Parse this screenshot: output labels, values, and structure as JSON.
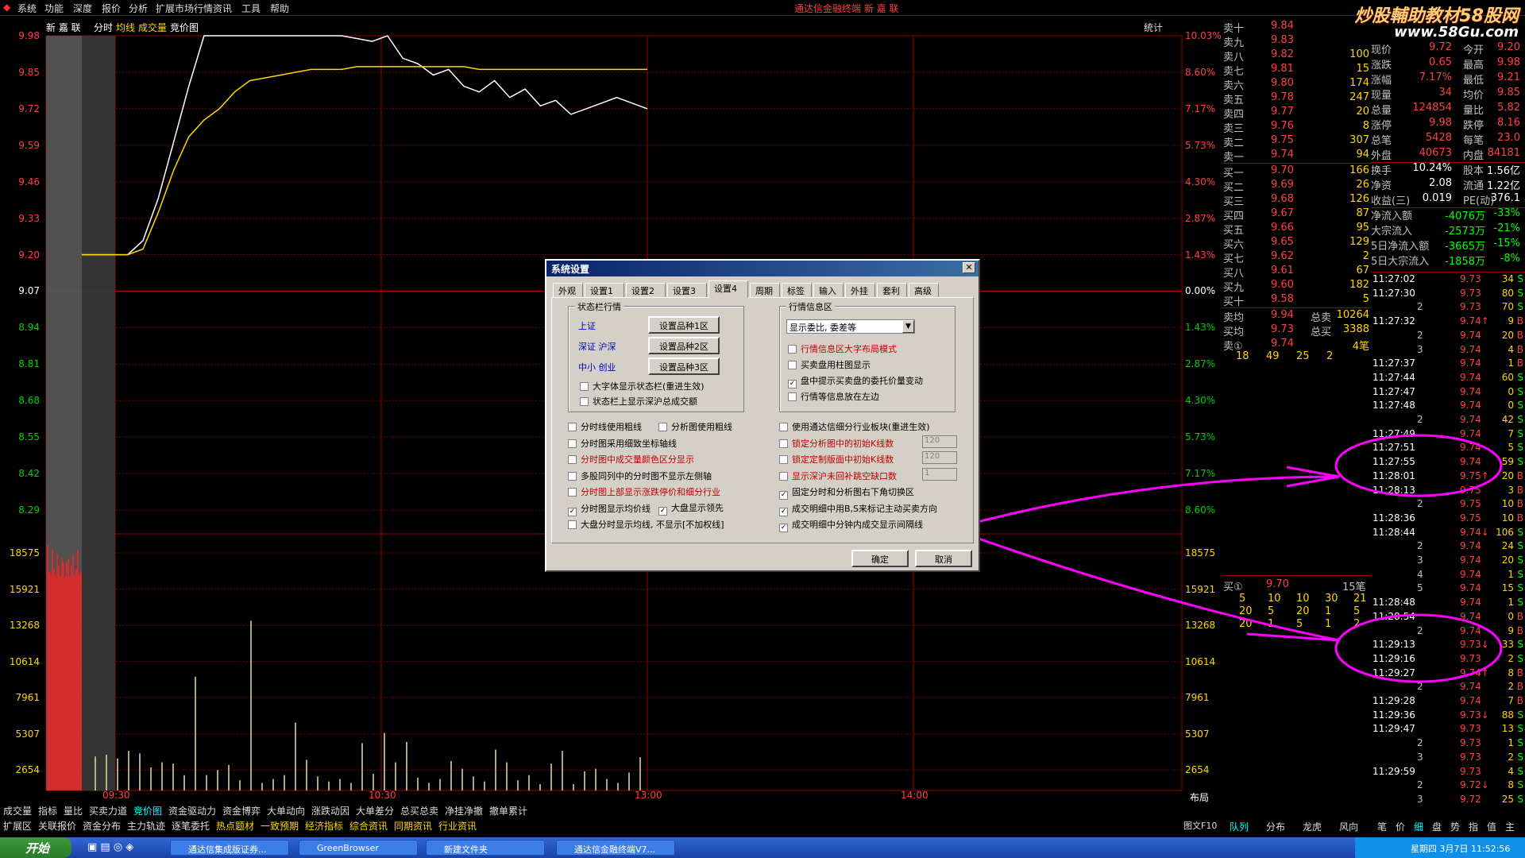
{
  "menu": [
    "系统",
    "功能",
    "深度",
    "报价",
    "分析",
    "扩展市场行情",
    "资讯",
    "工具",
    "帮助"
  ],
  "app_title": "通达信金融终端",
  "stock_name": "新 嘉 联",
  "watermark": {
    "line1": "炒股輔助教材58股网",
    "line2": "www.58Gu.com"
  },
  "chart_header": {
    "stock": "新 嘉 联",
    "items": [
      "分时",
      "均线",
      "成交量",
      "竞价图"
    ],
    "stat": "统计"
  },
  "chart_data": {
    "type": "line",
    "price_axis": [
      "9.98",
      "9.85",
      "9.72",
      "9.59",
      "9.46",
      "9.33",
      "9.20",
      "9.07",
      "8.94",
      "8.81",
      "8.68",
      "8.55",
      "8.42",
      "8.29"
    ],
    "pct_axis": [
      "10.03%",
      "8.60%",
      "7.17%",
      "5.73%",
      "4.30%",
      "2.87%",
      "1.43%",
      "0.00%",
      "1.43%",
      "2.87%",
      "4.30%",
      "5.73%",
      "7.17%",
      "8.60%"
    ],
    "volume_axis": [
      "18575",
      "15921",
      "13268",
      "10614",
      "7961",
      "5307",
      "2654"
    ],
    "time_labels": [
      "09:30",
      "10:30",
      "13:00",
      "14:00"
    ],
    "ylim": [
      8.16,
      9.98
    ],
    "series": [
      {
        "color": "#ffffff",
        "values": [
          9.2,
          9.2,
          9.2,
          9.2,
          9.25,
          9.4,
          9.6,
          9.8,
          9.98,
          9.98,
          9.98,
          9.98,
          9.98,
          9.98,
          9.98,
          9.98,
          9.98,
          9.98,
          9.97,
          9.96,
          9.98,
          9.9,
          9.88,
          9.84,
          9.86,
          9.8,
          9.78,
          9.82,
          9.76,
          9.79,
          9.73,
          9.75,
          9.7,
          9.72,
          9.74,
          9.76,
          9.74,
          9.72
        ]
      },
      {
        "color": "#ffd700",
        "values": [
          9.2,
          9.2,
          9.2,
          9.2,
          9.22,
          9.35,
          9.5,
          9.62,
          9.68,
          9.72,
          9.78,
          9.82,
          9.83,
          9.84,
          9.85,
          9.86,
          9.86,
          9.86,
          9.87,
          9.87,
          9.87,
          9.87,
          9.87,
          9.87,
          9.87,
          9.87,
          9.86,
          9.86,
          9.86,
          9.86,
          9.86,
          9.86,
          9.86,
          9.86,
          9.86,
          9.86,
          9.86,
          9.86
        ]
      }
    ],
    "volume_bars": [
      2654,
      2800,
      2500,
      3100,
      2900,
      1800,
      2200,
      2100,
      1200,
      8900,
      1200,
      1600,
      2000,
      800,
      13268,
      600,
      900,
      1200,
      5307,
      2400,
      1100,
      700,
      900,
      600,
      3700,
      1300,
      4500,
      2200,
      3800,
      1000,
      600,
      900,
      2300,
      1700,
      1100,
      700,
      3200,
      2200,
      800,
      1200,
      500,
      2100,
      3100,
      500,
      1500,
      1700,
      900,
      600,
      1400,
      2600
    ]
  },
  "bottom_tabs_1": [
    "成交量",
    "指标",
    "量比",
    "买卖力道",
    "竞价图",
    "资金驱动力",
    "资金博弈",
    "大单动向",
    "涨跌动因",
    "大单差分",
    "总买总卖",
    "净挂净撤",
    "撤单累计"
  ],
  "bottom_tabs_2": [
    "扩展区",
    "关联报价",
    "资金分布",
    "主力轨迹",
    "逐笔委托",
    "热点题材",
    "一致预期",
    "经济指标",
    "综合资讯",
    "同期资讯",
    "行业资讯"
  ],
  "layout_label": "布局",
  "fig_label": "图文F10",
  "sell_book": [
    {
      "label": "卖十",
      "price": "9.84",
      "vol": ""
    },
    {
      "label": "卖九",
      "price": "9.83",
      "vol": ""
    },
    {
      "label": "卖八",
      "price": "9.82",
      "vol": "100"
    },
    {
      "label": "卖七",
      "price": "9.81",
      "vol": "15"
    },
    {
      "label": "卖六",
      "price": "9.80",
      "vol": "174"
    },
    {
      "label": "卖五",
      "price": "9.78",
      "vol": "247"
    },
    {
      "label": "卖四",
      "price": "9.77",
      "vol": "20"
    },
    {
      "label": "卖三",
      "price": "9.76",
      "vol": "8"
    },
    {
      "label": "卖二",
      "price": "9.75",
      "vol": "307"
    },
    {
      "label": "卖一",
      "price": "9.74",
      "vol": "94"
    }
  ],
  "buy_book": [
    {
      "label": "买一",
      "price": "9.70",
      "vol": "166"
    },
    {
      "label": "买二",
      "price": "9.69",
      "vol": "26"
    },
    {
      "label": "买三",
      "price": "9.68",
      "vol": "126"
    },
    {
      "label": "买四",
      "price": "9.67",
      "vol": "87"
    },
    {
      "label": "买五",
      "price": "9.66",
      "vol": "95"
    },
    {
      "label": "买六",
      "price": "9.65",
      "vol": "129"
    },
    {
      "label": "买七",
      "price": "9.62",
      "vol": "2"
    },
    {
      "label": "买八",
      "price": "9.61",
      "vol": "67"
    },
    {
      "label": "买九",
      "price": "9.60",
      "vol": "182"
    },
    {
      "label": "买十",
      "price": "9.58",
      "vol": "5"
    }
  ],
  "book_summary": [
    {
      "l": "卖均",
      "v": "9.94",
      "l2": "总卖",
      "v2": "10264"
    },
    {
      "l": "买均",
      "v": "9.73",
      "l2": "总买",
      "v2": "3388"
    },
    {
      "l": "卖①",
      "v": "9.74",
      "l2": "",
      "v2": "4笔"
    }
  ],
  "book_queue": [
    "18",
    "49",
    "25",
    "2"
  ],
  "buy_queue_head": {
    "l": "买①",
    "v": "9.70",
    "n": "15笔"
  },
  "buy_queue": [
    [
      "5",
      "10",
      "10",
      "30",
      "21"
    ],
    [
      "20",
      "5",
      "20",
      "1",
      "5"
    ],
    [
      "20",
      "1",
      "5",
      "1",
      "2"
    ]
  ],
  "stats": [
    {
      "l": "现价",
      "v": "9.72",
      "l2": "今开",
      "v2": "9.20"
    },
    {
      "l": "涨跌",
      "v": "0.65",
      "l2": "最高",
      "v2": "9.98"
    },
    {
      "l": "涨幅",
      "v": "7.17%",
      "l2": "最低",
      "v2": "9.21"
    },
    {
      "l": "现量",
      "v": "34",
      "l2": "均价",
      "v2": "9.85"
    },
    {
      "l": "总量",
      "v": "124854",
      "l2": "量比",
      "v2": "5.82"
    },
    {
      "l": "涨停",
      "v": "9.98",
      "l2": "跌停",
      "v2": "8.16"
    },
    {
      "l": "总笔",
      "v": "5428",
      "l2": "每笔",
      "v2": "23.0"
    },
    {
      "l": "外盘",
      "v": "40673",
      "l2": "内盘",
      "v2": "84181"
    },
    {
      "l": "换手",
      "v": "10.24%",
      "l2": "股本",
      "v2": "1.56亿"
    },
    {
      "l": "净资",
      "v": "2.08",
      "l2": "流通",
      "v2": "1.22亿"
    },
    {
      "l": "收益(三)",
      "v": "0.019",
      "l2": "PE(动)",
      "v2": "376.1"
    },
    {
      "l": "净流入额",
      "v": "-4076万",
      "l2": "",
      "v2": "-33%"
    },
    {
      "l": "大宗流入",
      "v": "-2573万",
      "l2": "",
      "v2": "-21%"
    },
    {
      "l": "5日净流入额",
      "v": "-3665万",
      "l2": "",
      "v2": "-15%"
    },
    {
      "l": "5日大宗流入",
      "v": "-1858万",
      "l2": "",
      "v2": "-8%"
    }
  ],
  "ticks": [
    {
      "t": "11:27:02",
      "p": "9.73",
      "v": "34",
      "f": "S"
    },
    {
      "t": "11:27:30",
      "p": "9.73",
      "v": "80",
      "f": "S"
    },
    {
      "t": "2",
      "p": "9.73",
      "v": "70",
      "f": "S"
    },
    {
      "t": "11:27:32",
      "p": "9.74↑",
      "v": "9",
      "f": "B"
    },
    {
      "t": "2",
      "p": "9.74",
      "v": "20",
      "f": "B"
    },
    {
      "t": "3",
      "p": "9.74",
      "v": "4",
      "f": "B"
    },
    {
      "t": "11:27:37",
      "p": "9.74",
      "v": "1",
      "f": "B"
    },
    {
      "t": "11:27:44",
      "p": "9.74",
      "v": "60",
      "f": "S"
    },
    {
      "t": "11:27:47",
      "p": "9.74",
      "v": "0",
      "f": "S"
    },
    {
      "t": "11:27:48",
      "p": "9.74",
      "v": "0",
      "f": "S"
    },
    {
      "t": "2",
      "p": "9.74",
      "v": "42",
      "f": "S"
    },
    {
      "t": "11:27:49",
      "p": "9.74",
      "v": "7",
      "f": "S"
    },
    {
      "t": "11:27:51",
      "p": "9.74",
      "v": "5",
      "f": "S"
    },
    {
      "t": "11:27:55",
      "p": "9.74",
      "v": "59",
      "f": "S"
    },
    {
      "t": "11:28:01",
      "p": "9.75↑",
      "v": "20",
      "f": "B"
    },
    {
      "t": "11:28:13",
      "p": "9.75",
      "v": "3",
      "f": "B"
    },
    {
      "t": "2",
      "p": "9.75",
      "v": "10",
      "f": "B"
    },
    {
      "t": "11:28:36",
      "p": "9.75",
      "v": "10",
      "f": "B"
    },
    {
      "t": "11:28:44",
      "p": "9.74↓",
      "v": "106",
      "f": "S"
    },
    {
      "t": "2",
      "p": "9.74",
      "v": "24",
      "f": "S"
    },
    {
      "t": "3",
      "p": "9.74",
      "v": "20",
      "f": "S"
    },
    {
      "t": "4",
      "p": "9.74",
      "v": "1",
      "f": "S"
    },
    {
      "t": "5",
      "p": "9.74",
      "v": "15",
      "f": "S"
    },
    {
      "t": "11:28:48",
      "p": "9.74",
      "v": "1",
      "f": "S"
    },
    {
      "t": "11:28:54",
      "p": "9.74",
      "v": "0",
      "f": "B"
    },
    {
      "t": "2",
      "p": "9.74",
      "v": "9",
      "f": "B"
    },
    {
      "t": "11:29:13",
      "p": "9.73↓",
      "v": "33",
      "f": "S"
    },
    {
      "t": "11:29:16",
      "p": "9.73",
      "v": "2",
      "f": "S"
    },
    {
      "t": "11:29:27",
      "p": "9.74↑",
      "v": "8",
      "f": "B"
    },
    {
      "t": "2",
      "p": "9.74",
      "v": "2",
      "f": "B"
    },
    {
      "t": "11:29:28",
      "p": "9.74",
      "v": "7",
      "f": "B"
    },
    {
      "t": "11:29:36",
      "p": "9.73↓",
      "v": "88",
      "f": "S"
    },
    {
      "t": "11:29:47",
      "p": "9.73",
      "v": "13",
      "f": "S"
    },
    {
      "t": "2",
      "p": "9.73",
      "v": "1",
      "f": "S"
    },
    {
      "t": "3",
      "p": "9.73",
      "v": "2",
      "f": "S"
    },
    {
      "t": "11:29:59",
      "p": "9.73",
      "v": "4",
      "f": "S"
    },
    {
      "t": "2",
      "p": "9.72↓",
      "v": "8",
      "f": "S"
    },
    {
      "t": "3",
      "p": "9.72",
      "v": "25",
      "f": "S"
    }
  ],
  "right_tabs_1": [
    "队列",
    "分布",
    "龙虎",
    "风向"
  ],
  "right_tabs_2": [
    "笔",
    "价",
    "细",
    "盘",
    "势",
    "指",
    "值",
    "主"
  ],
  "dialog": {
    "title": "系统设置",
    "close": "✕",
    "tabs": [
      "外观",
      "设置1",
      "设置2",
      "设置3",
      "设置4",
      "周期",
      "标签",
      "输入",
      "外挂",
      "套利",
      "高级"
    ],
    "group_status": "状态栏行情",
    "status_items": [
      {
        "name": "上证",
        "btn": "设置品种1区"
      },
      {
        "name": "深证 沪深",
        "btn": "设置品种2区"
      },
      {
        "name": "中小 创业",
        "btn": "设置品种3区"
      }
    ],
    "status_checks": [
      {
        "label": "大字体显示状态栏(重进生效)",
        "checked": false,
        "red": false
      },
      {
        "label": "状态栏上显示深沪总成交额",
        "checked": false,
        "red": false
      }
    ],
    "group_quote": "行情信息区",
    "quote_select": "显示委比, 委差等",
    "quote_checks": [
      {
        "label": "行情信息区大字布局模式",
        "checked": false,
        "red": true
      },
      {
        "label": "买卖盘用柱图显示",
        "checked": false,
        "red": false
      },
      {
        "label": "盘中提示买卖盘的委托价量变动",
        "checked": true,
        "red": false
      },
      {
        "label": "行情等信息放在左边",
        "checked": false,
        "red": false
      }
    ],
    "left_checks": [
      {
        "label": "分时线使用粗线",
        "checked": false,
        "red": false
      },
      {
        "label": "分时图采用细致坐标轴线",
        "checked": false,
        "red": false
      },
      {
        "label": "分时图中成交量颜色区分显示",
        "checked": false,
        "red": true
      },
      {
        "label": "多股同列中的分时图不显示左侧轴",
        "checked": false,
        "red": false
      },
      {
        "label": "分时图上部显示涨跌停价和细分行业",
        "checked": false,
        "red": true
      },
      {
        "label": "分时图显示均价线",
        "checked": true,
        "red": false
      },
      {
        "label": "大盘分时显示均线, 不显示[不加权线]",
        "checked": false,
        "red": false
      }
    ],
    "left_extra": [
      {
        "label": "分析图使用粗线",
        "checked": false
      },
      {
        "label": "大盘显示领先",
        "checked": true
      }
    ],
    "right_checks": [
      {
        "label": "使用通达信细分行业板块(重进生效)",
        "checked": false,
        "red": false
      },
      {
        "label": "锁定分析图中的初始K线数",
        "checked": false,
        "red": true,
        "val": "120"
      },
      {
        "label": "锁定定制版面中初始K线数",
        "checked": false,
        "red": true,
        "val": "120"
      },
      {
        "label": "显示深沪未回补跳空缺口数",
        "checked": false,
        "red": true,
        "val": "1"
      },
      {
        "label": "固定分时和分析图右下角切换区",
        "checked": true,
        "red": false
      },
      {
        "label": "成交明细中用B,S来标记主动买卖方向",
        "checked": true,
        "red": false
      },
      {
        "label": "成交明细中分钟内成交显示间隔线",
        "checked": true,
        "red": false
      }
    ],
    "ok": "确定",
    "cancel": "取消"
  },
  "taskbar": {
    "start": "开始",
    "tasks": [
      "通达信集成版证券...",
      "GreenBrowser",
      "新建文件夹",
      "通达信金融终端V7..."
    ],
    "clock": "星期四 3月7日 11:52:56"
  }
}
